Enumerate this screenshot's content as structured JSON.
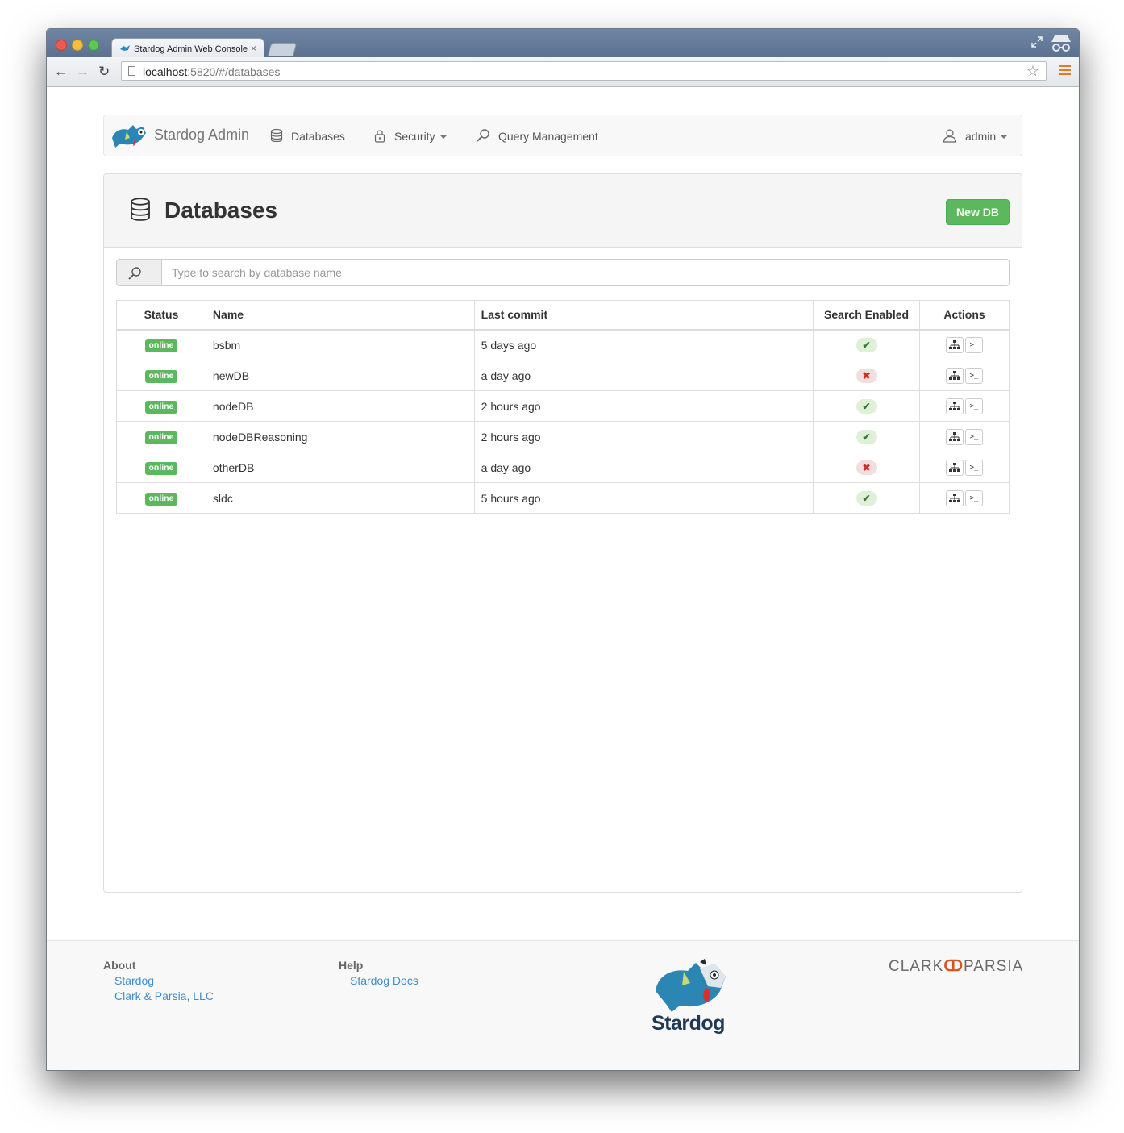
{
  "browser": {
    "tab_title": "Stardog Admin Web Console",
    "tab_close": "×",
    "url_host": "localhost",
    "url_rest": ":5820/#/databases",
    "back_icon": "←",
    "forward_icon": "→",
    "reload_icon": "↻",
    "star_icon": "☆"
  },
  "navbar": {
    "brand": "Stardog Admin",
    "items": [
      {
        "label": "Databases",
        "icon": "database-icon"
      },
      {
        "label": "Security",
        "icon": "lock-icon",
        "dropdown": true
      },
      {
        "label": "Query Management",
        "icon": "search-icon"
      }
    ],
    "user": {
      "label": "admin",
      "icon": "user-icon",
      "dropdown": true
    }
  },
  "panel": {
    "title": "Databases",
    "new_button": "New DB",
    "search_placeholder": "Type to search by database name"
  },
  "table": {
    "columns": [
      "Status",
      "Name",
      "Last commit",
      "Search Enabled",
      "Actions"
    ],
    "rows": [
      {
        "status": "online",
        "name": "bsbm",
        "last_commit": "5 days ago",
        "search_enabled": true
      },
      {
        "status": "online",
        "name": "newDB",
        "last_commit": "a day ago",
        "search_enabled": false
      },
      {
        "status": "online",
        "name": "nodeDB",
        "last_commit": "2 hours ago",
        "search_enabled": true
      },
      {
        "status": "online",
        "name": "nodeDBReasoning",
        "last_commit": "2 hours ago",
        "search_enabled": true
      },
      {
        "status": "online",
        "name": "otherDB",
        "last_commit": "a day ago",
        "search_enabled": false
      },
      {
        "status": "online",
        "name": "sldc",
        "last_commit": "5 hours ago",
        "search_enabled": true
      }
    ],
    "check_glyph": "✔",
    "cross_glyph": "✖",
    "action_buttons": [
      {
        "icon": "sitemap-icon",
        "glyph": "⌘"
      },
      {
        "icon": "terminal-icon",
        "glyph": ">_"
      }
    ]
  },
  "footer": {
    "about": {
      "heading": "About",
      "links": [
        "Stardog",
        "Clark & Parsia, LLC"
      ]
    },
    "help": {
      "heading": "Help",
      "links": [
        "Stardog Docs"
      ]
    },
    "logo_word": "Stardog",
    "company": {
      "left": "CLARK",
      "mark": "ↀ",
      "right": "PARSIA"
    }
  },
  "colors": {
    "success": "#5cb85c",
    "link": "#428bca",
    "danger": "#c9302c",
    "titlebar": "#6f86a3"
  }
}
